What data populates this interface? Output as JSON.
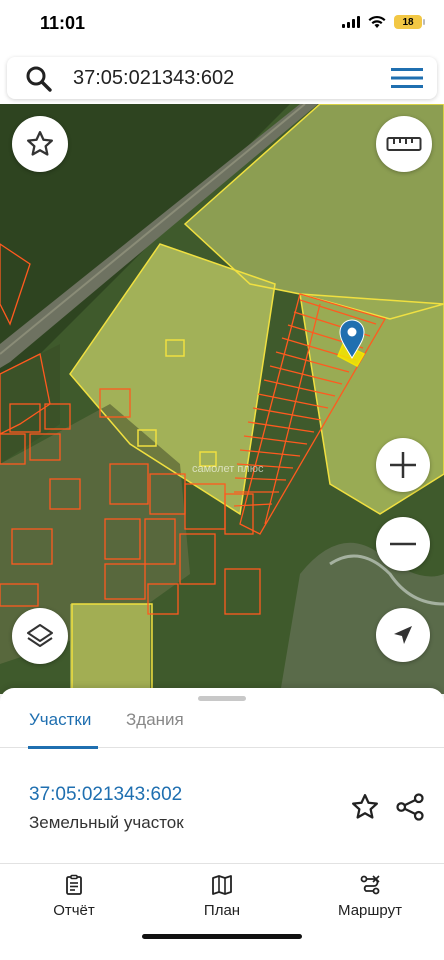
{
  "status_bar": {
    "time": "11:01",
    "battery": "18"
  },
  "search": {
    "query": "37:05:021343:602"
  },
  "map": {
    "watermark": "самолет плюс"
  },
  "panel": {
    "tabs": [
      {
        "label": "Участки",
        "active": true
      },
      {
        "label": "Здания",
        "active": false
      }
    ],
    "result": {
      "number": "37:05:021343:602",
      "type": "Земельный участок"
    }
  },
  "bottom_nav": {
    "items": [
      {
        "label": "Отчёт",
        "icon": "report-icon"
      },
      {
        "label": "План",
        "icon": "map-icon"
      },
      {
        "label": "Маршрут",
        "icon": "route-icon"
      }
    ]
  },
  "colors": {
    "accent": "#1f6fb0",
    "parcel_outline": "#ff5a1f",
    "highlight": "#f5e400"
  }
}
